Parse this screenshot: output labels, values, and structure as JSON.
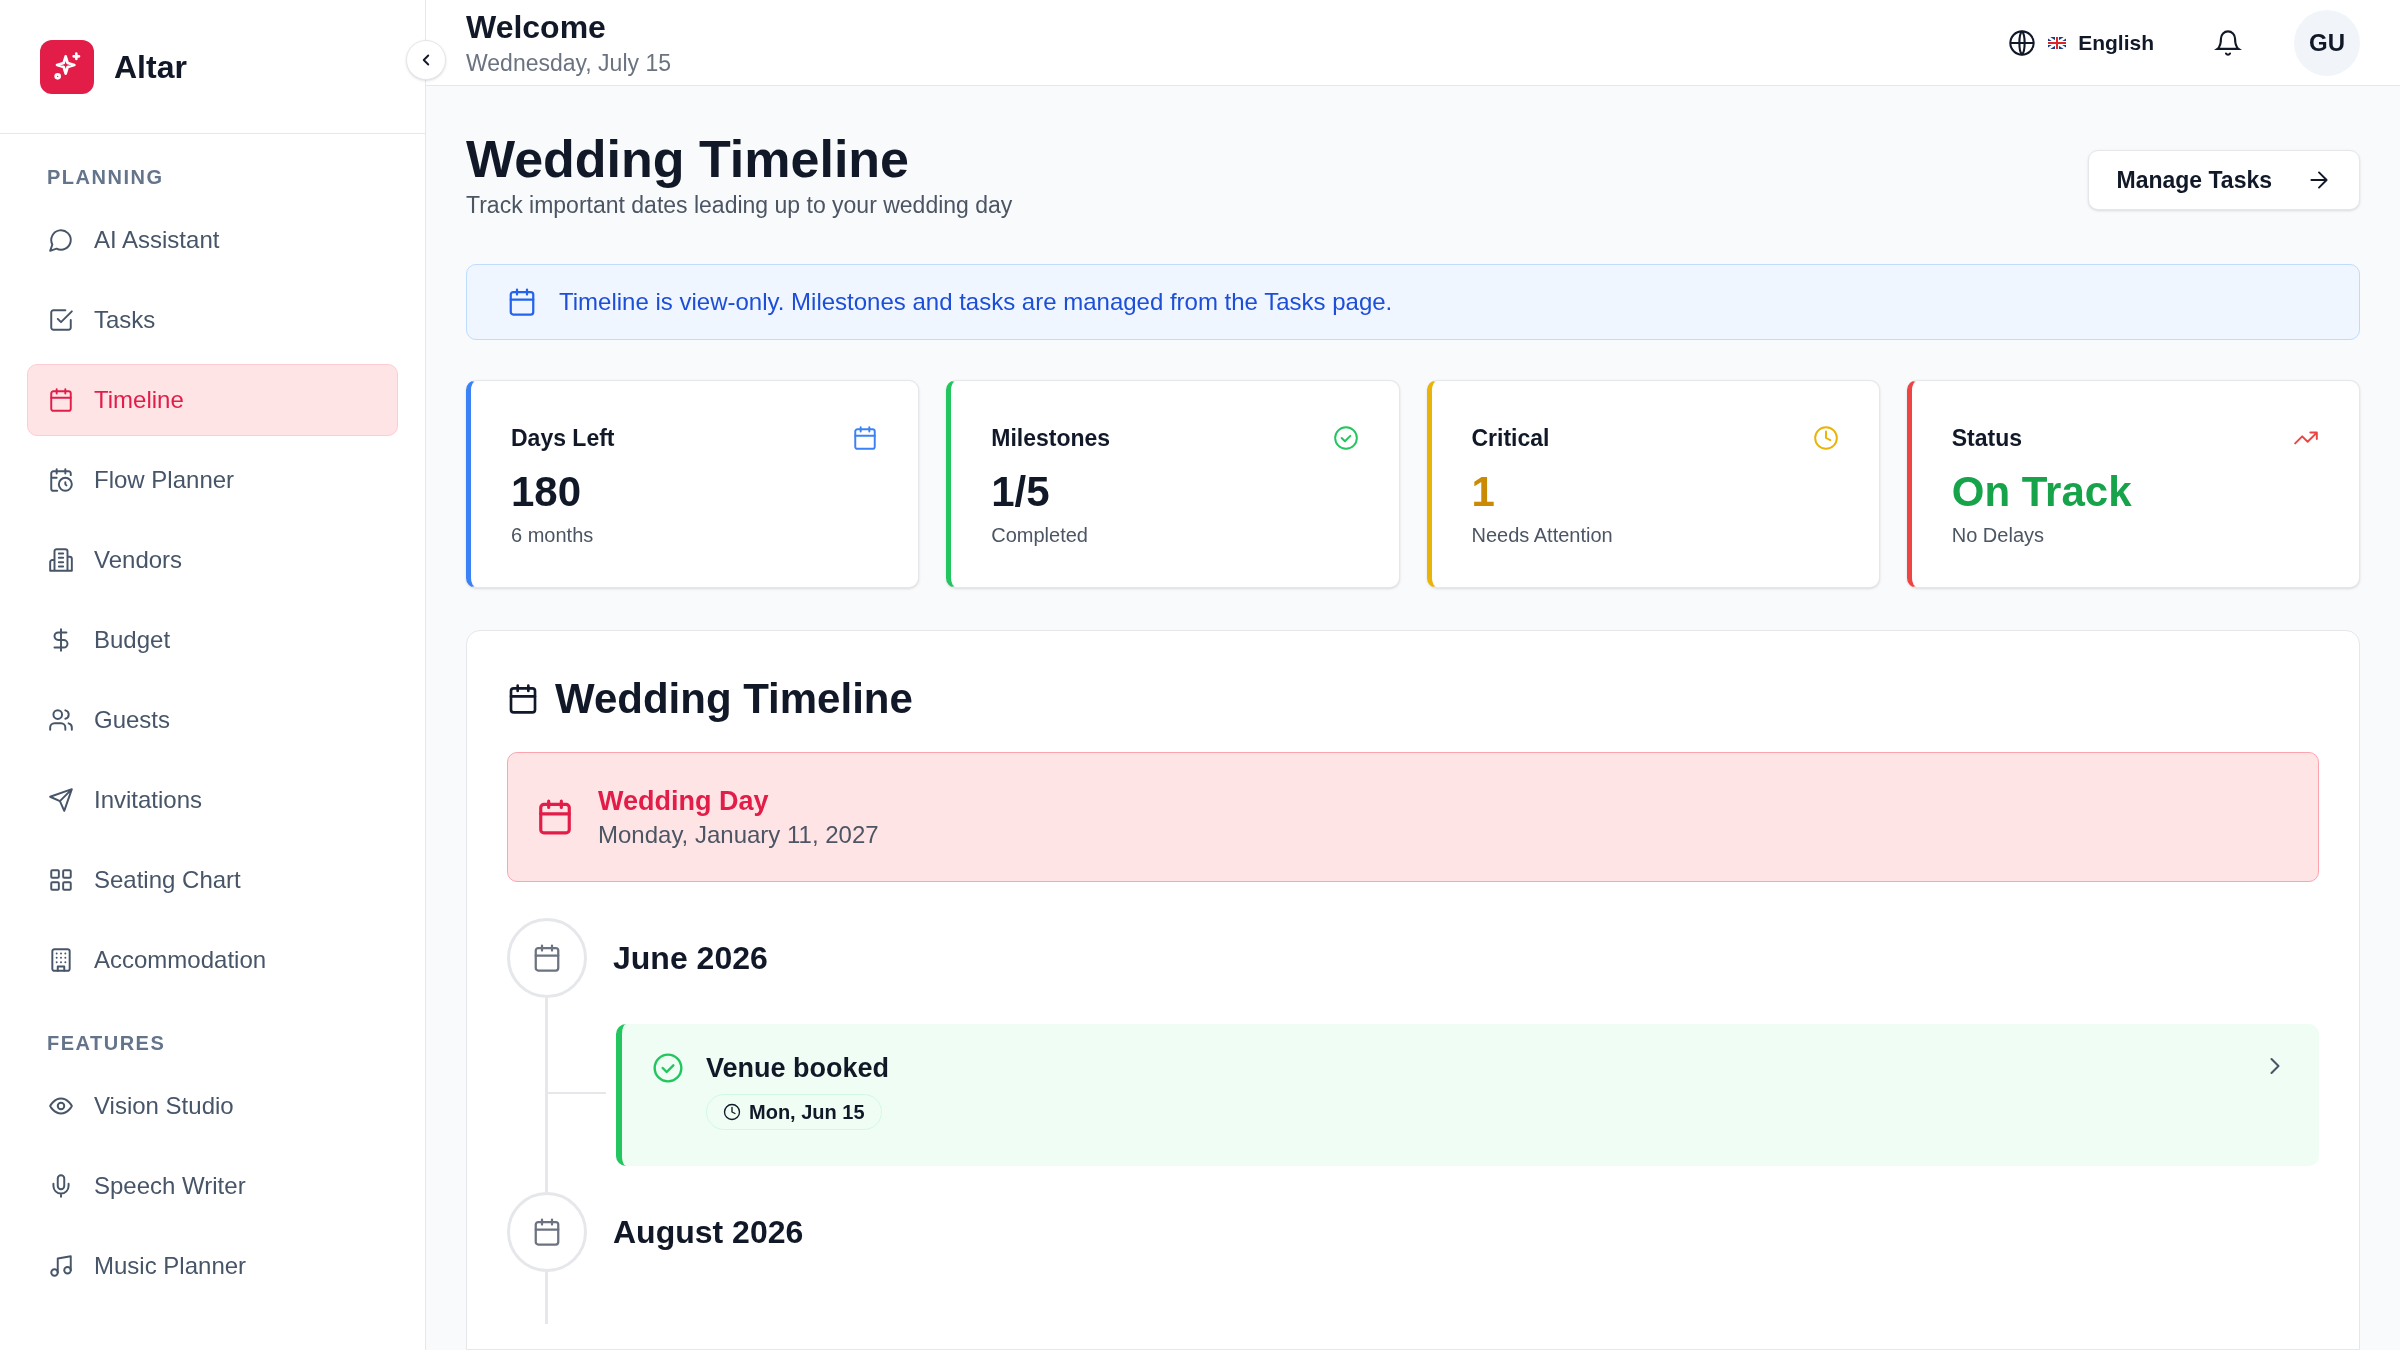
{
  "app": {
    "name": "Altar"
  },
  "sidebar": {
    "sections": [
      {
        "label": "PLANNING",
        "items": [
          {
            "label": "AI Assistant",
            "selected": false
          },
          {
            "label": "Tasks",
            "selected": false
          },
          {
            "label": "Timeline",
            "selected": true
          },
          {
            "label": "Flow Planner",
            "selected": false
          },
          {
            "label": "Vendors",
            "selected": false
          },
          {
            "label": "Budget",
            "selected": false
          },
          {
            "label": "Guests",
            "selected": false
          },
          {
            "label": "Invitations",
            "selected": false
          },
          {
            "label": "Seating Chart",
            "selected": false
          },
          {
            "label": "Accommodation",
            "selected": false
          }
        ]
      },
      {
        "label": "FEATURES",
        "items": [
          {
            "label": "Vision Studio",
            "selected": false
          },
          {
            "label": "Speech Writer",
            "selected": false
          },
          {
            "label": "Music Planner",
            "selected": false
          }
        ]
      }
    ]
  },
  "header": {
    "title": "Welcome",
    "date": "Wednesday, July 15",
    "language": "English",
    "avatar": "GU"
  },
  "page": {
    "title": "Wedding Timeline",
    "subtitle": "Track important dates leading up to your wedding day",
    "action": "Manage Tasks",
    "notice": "Timeline is view-only. Milestones and tasks are managed from the Tasks page."
  },
  "stats": [
    {
      "label": "Days Left",
      "value": "180",
      "note": "6 months",
      "color": "#3b82f6",
      "kind": "plain"
    },
    {
      "label": "Milestones",
      "value": "1/5",
      "note": "Completed",
      "color": "#22c55e",
      "kind": "plain"
    },
    {
      "label": "Critical",
      "value": "1",
      "note": "Needs Attention",
      "color": "#eab308",
      "kind": "warning"
    },
    {
      "label": "Status",
      "value": "On Track",
      "note": "No Delays",
      "color": "#ef4444",
      "kind": "success"
    }
  ],
  "timeline": {
    "title": "Wedding Timeline",
    "wedding": {
      "title": "Wedding Day",
      "date": "Monday, January 11, 2027"
    },
    "months": [
      {
        "label": "June 2026",
        "items": [
          {
            "title": "Venue booked",
            "date": "Mon, Jun 15",
            "done": true
          }
        ]
      },
      {
        "label": "August 2026"
      }
    ]
  }
}
